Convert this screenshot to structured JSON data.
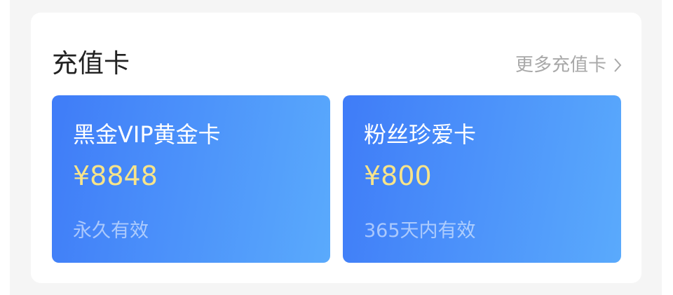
{
  "section": {
    "title": "充值卡",
    "more_label": "更多充值卡",
    "more_icon": "chevron-right-icon"
  },
  "colors": {
    "card_gradient_start": "#3f7cf8",
    "card_gradient_end": "#5aaafc",
    "price": "#f7e48a"
  },
  "cards": [
    {
      "name": "黑金VIP黄金卡",
      "price": "¥8848",
      "validity": "永久有效"
    },
    {
      "name": "粉丝珍爱卡",
      "price": "¥800",
      "validity": "365天内有效"
    }
  ]
}
